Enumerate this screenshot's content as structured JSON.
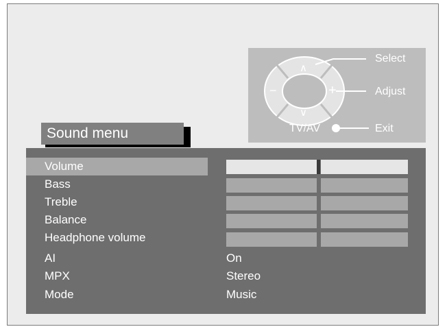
{
  "remote_hint": {
    "select_label": "Select",
    "adjust_label": "Adjust",
    "exit_label": "Exit",
    "tvav_label": "TV/AV",
    "up_arrow": "∧",
    "down_arrow": "∨",
    "minus_sign": "−",
    "plus_sign": "+"
  },
  "title": "Sound menu",
  "menu": {
    "items": [
      {
        "label": "Volume"
      },
      {
        "label": "Bass"
      },
      {
        "label": "Treble"
      },
      {
        "label": "Balance"
      },
      {
        "label": "Headphone volume"
      },
      {
        "label": "AI"
      },
      {
        "label": "MPX"
      },
      {
        "label": "Mode"
      }
    ],
    "selected_index": 0,
    "values": {
      "ai": "On",
      "mpx": "Stereo",
      "mode": "Music"
    }
  },
  "colors": {
    "panel_bg": "#6e6e6e",
    "selected_bg": "#a8a8a8",
    "active_bar": "#e6e6e6",
    "hint_bg": "#bdbdbd"
  }
}
